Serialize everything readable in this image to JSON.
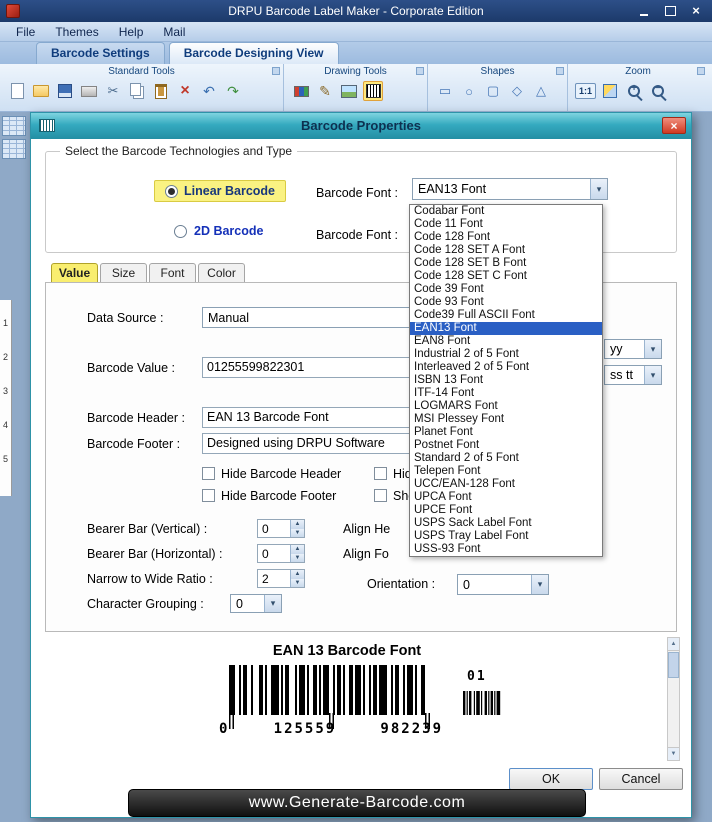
{
  "window": {
    "title": "DRPU Barcode Label Maker - Corporate Edition",
    "menu": [
      "File",
      "Themes",
      "Help",
      "Mail"
    ],
    "tabs": [
      {
        "label": "Barcode Settings",
        "active": false
      },
      {
        "label": "Barcode Designing View",
        "active": true
      }
    ],
    "toolbar": {
      "groups": [
        "Standard Tools",
        "Drawing Tools",
        "Shapes",
        "Zoom"
      ],
      "zoom_ratio": "1:1"
    },
    "ruler_numbers": [
      "1",
      "2",
      "3",
      "4",
      "5"
    ]
  },
  "dialog": {
    "title": "Barcode Properties",
    "technology_group": {
      "legend": "Select the Barcode Technologies and Type",
      "linear_label": "Linear Barcode",
      "twod_label": "2D Barcode",
      "font_label_1": "Barcode Font :",
      "font_label_2": "Barcode Font :",
      "font_value": "EAN13 Font"
    },
    "font_options": [
      {
        "label": "Codabar Font"
      },
      {
        "label": "Code 11 Font"
      },
      {
        "label": "Code 128 Font"
      },
      {
        "label": "Code 128 SET A Font"
      },
      {
        "label": "Code 128 SET B Font"
      },
      {
        "label": "Code 128 SET C Font"
      },
      {
        "label": "Code 39 Font"
      },
      {
        "label": "Code 93 Font"
      },
      {
        "label": "Code39 Full ASCII Font"
      },
      {
        "label": "EAN13 Font",
        "selected": true
      },
      {
        "label": "EAN8 Font"
      },
      {
        "label": "Industrial 2 of 5 Font"
      },
      {
        "label": "Interleaved 2 of 5 Font"
      },
      {
        "label": "ISBN 13 Font"
      },
      {
        "label": "ITF-14 Font"
      },
      {
        "label": "LOGMARS Font"
      },
      {
        "label": "MSI Plessey Font"
      },
      {
        "label": "Planet Font"
      },
      {
        "label": "Postnet Font"
      },
      {
        "label": "Standard 2 of 5 Font"
      },
      {
        "label": "Telepen Font"
      },
      {
        "label": "UCC/EAN-128 Font"
      },
      {
        "label": "UPCA Font"
      },
      {
        "label": "UPCE Font"
      },
      {
        "label": "USPS Sack Label Font"
      },
      {
        "label": "USPS Tray Label Font"
      },
      {
        "label": "USS-93 Font"
      }
    ],
    "tabs": [
      {
        "label": "Value",
        "active": true
      },
      {
        "label": "Size",
        "active": false
      },
      {
        "label": "Font",
        "active": false
      },
      {
        "label": "Color",
        "active": false
      }
    ],
    "form": {
      "data_source_label": "Data Source :",
      "data_source_value": "Manual",
      "barcode_value_label": "Barcode Value :",
      "barcode_value": "01255599822301",
      "header_label": "Barcode Header :",
      "header_value": "EAN 13 Barcode Font",
      "footer_label": "Barcode Footer :",
      "footer_value": "Designed using DRPU Software",
      "hide_header_label": "Hide Barcode Header",
      "hide_footer_label": "Hide Barcode Footer",
      "hide_partial_label": "Hide",
      "show_partial_label": "Show",
      "bearer_vertical_label": "Bearer Bar (Vertical) :",
      "bearer_vertical_value": "0",
      "bearer_horizontal_label": "Bearer Bar (Horizontal) :",
      "bearer_horizontal_value": "0",
      "narrow_wide_label": "Narrow to Wide Ratio :",
      "narrow_wide_value": "2",
      "char_grouping_label": "Character Grouping :",
      "char_grouping_value": "0",
      "align_header_partial": "Align He",
      "align_footer_partial": "Align Fo",
      "orientation_label": "Orientation :",
      "orientation_value": "0",
      "partial_combo_top": "yy",
      "partial_combo_bottom": "ss tt"
    },
    "preview": {
      "title": "EAN 13 Barcode Font",
      "digit_lead": "0",
      "digit_left": "125559",
      "digit_right": "982239",
      "addon": "01"
    },
    "buttons": {
      "ok": "OK",
      "cancel": "Cancel"
    }
  },
  "footer": {
    "url": "www.Generate-Barcode.com"
  },
  "colors": {
    "accent_teal": "#2ba0b4",
    "highlight_yellow": "#f9ee6f",
    "selection_blue": "#2a5fc4",
    "titlebar_navy": "#1d3f74"
  }
}
